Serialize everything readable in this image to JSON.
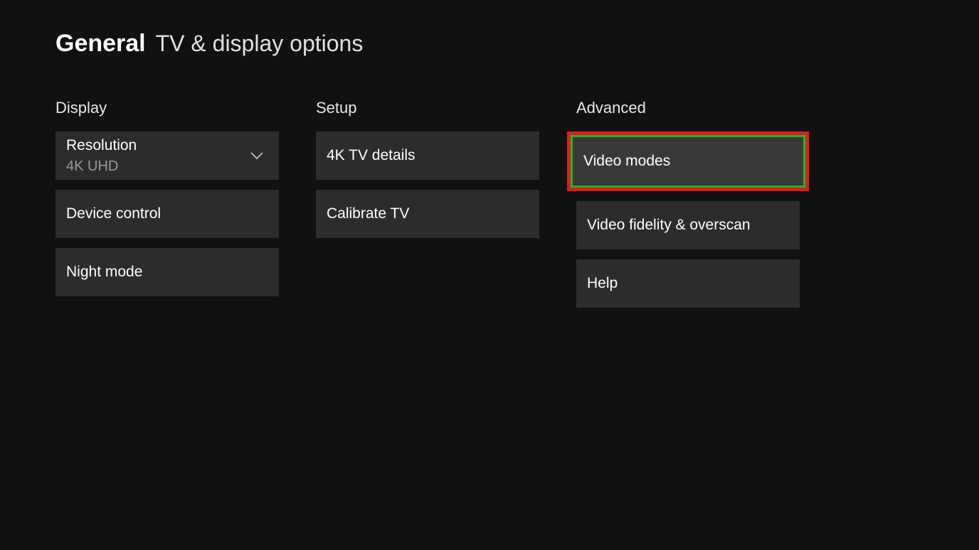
{
  "header": {
    "main": "General",
    "sub": "TV & display options"
  },
  "columns": {
    "display": {
      "title": "Display",
      "resolution": {
        "label": "Resolution",
        "value": "4K UHD"
      },
      "device_control": "Device control",
      "night_mode": "Night mode"
    },
    "setup": {
      "title": "Setup",
      "tv_details": "4K TV details",
      "calibrate": "Calibrate TV"
    },
    "advanced": {
      "title": "Advanced",
      "video_modes": "Video modes",
      "video_fidelity": "Video fidelity & overscan",
      "help": "Help"
    }
  }
}
